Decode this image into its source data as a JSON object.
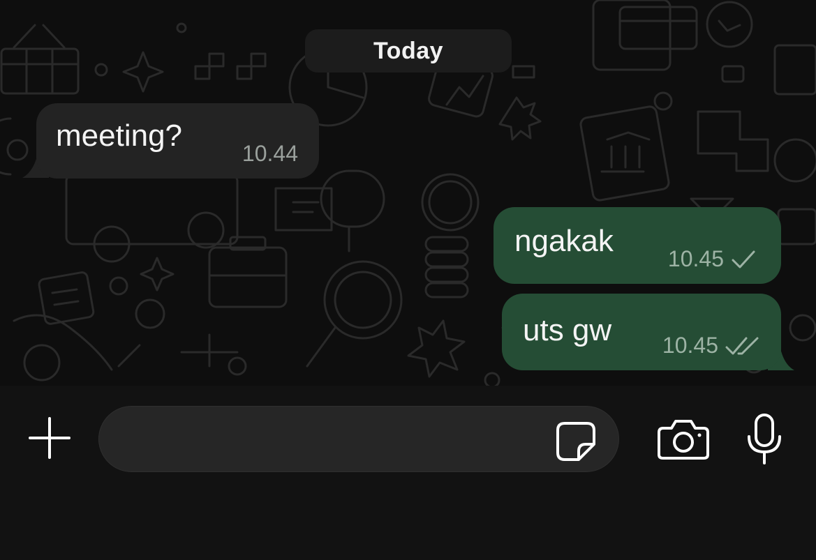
{
  "date_separator": "Today",
  "messages": [
    {
      "direction": "incoming",
      "text": "meeting?",
      "time": "10.44",
      "status": ""
    },
    {
      "direction": "outgoing",
      "text": "ngakak",
      "time": "10.45",
      "status": "sent"
    },
    {
      "direction": "outgoing",
      "text": "uts gw",
      "time": "10.45",
      "status": "delivered"
    }
  ],
  "composer": {
    "placeholder": "",
    "value": "",
    "icons": {
      "attach": "plus-icon",
      "sticker": "sticker-icon",
      "camera": "camera-icon",
      "mic": "microphone-icon"
    }
  },
  "colors": {
    "background": "#0e0e0e",
    "incoming_bubble": "#232323",
    "outgoing_bubble": "#254d35",
    "input_bar": "#121212",
    "icon": "#ffffff"
  }
}
